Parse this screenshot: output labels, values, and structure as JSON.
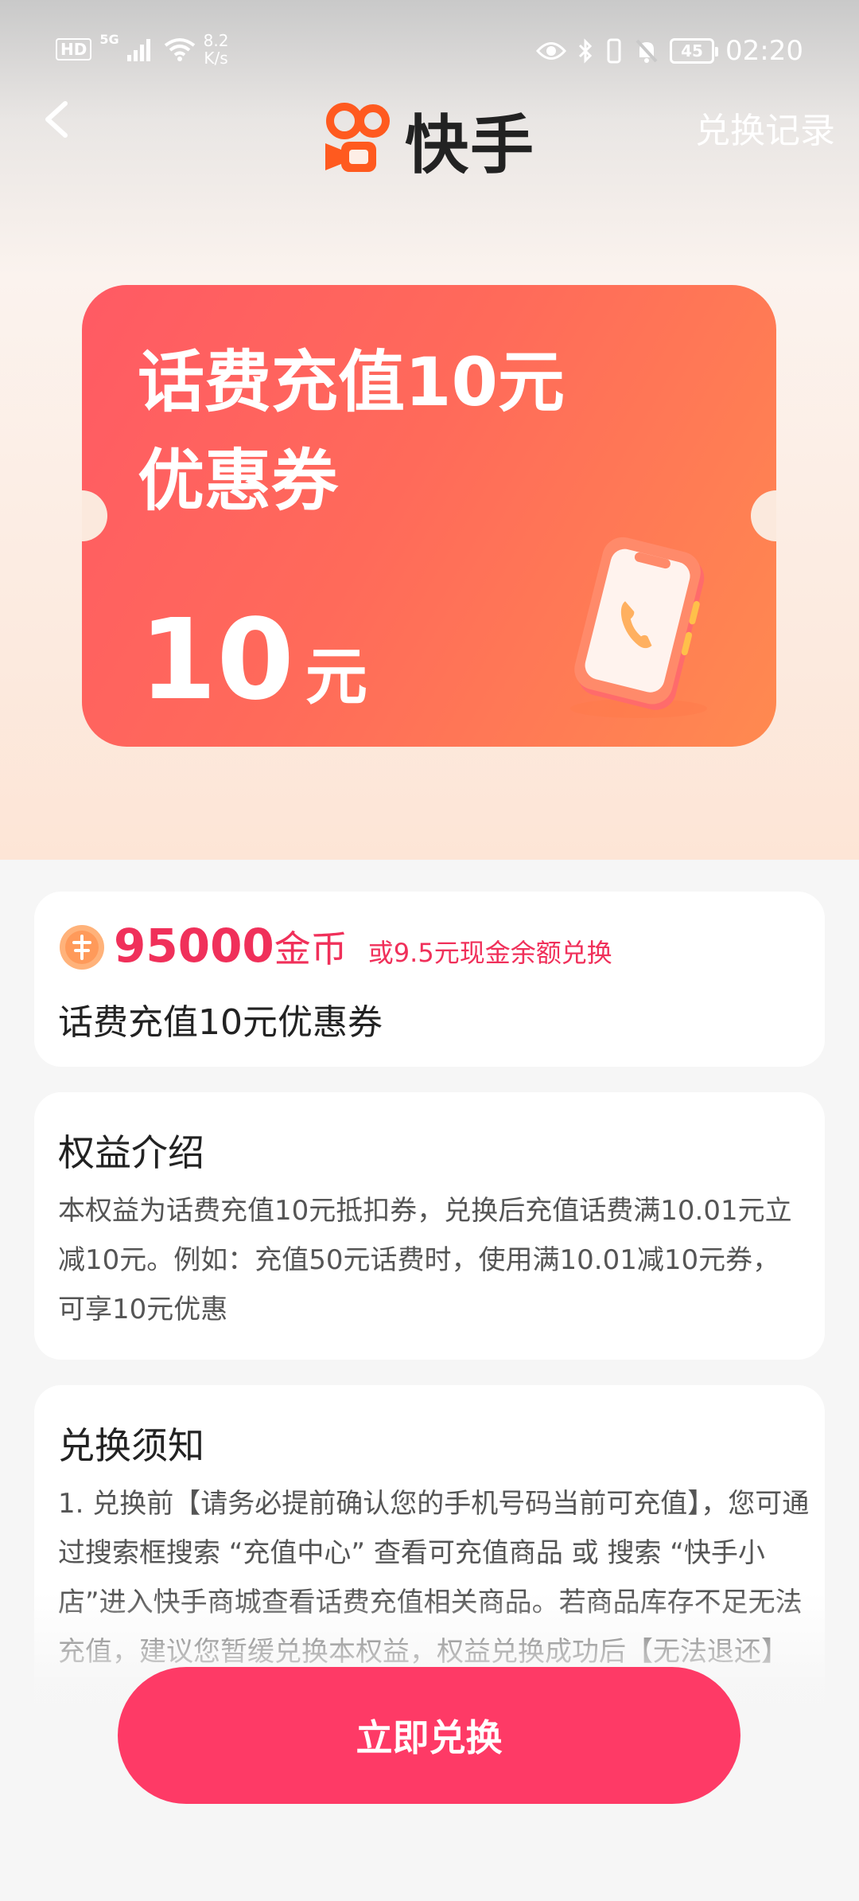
{
  "status_bar": {
    "hd": "HD",
    "network": "5G",
    "speed_value": "8.2",
    "speed_unit": "K/s",
    "battery": "45",
    "time": "02:20"
  },
  "header": {
    "logo_text": "快手",
    "record_link": "兑换记录"
  },
  "coupon": {
    "title_line1": "话费充值10元",
    "title_line2": "优惠券",
    "amount": "10",
    "amount_unit": "元"
  },
  "price_card": {
    "coins": "95000",
    "coins_unit": "金币",
    "alt_price": "或9.5元现金余额兑换",
    "product_name": "话费充值10元优惠券"
  },
  "benefit_card": {
    "title": "权益介绍",
    "body": "本权益为话费充值10元抵扣券，兑换后充值话费满10.01元立减10元。例如：充值50元话费时，使用满10.01减10元券，可享10元优惠"
  },
  "notice_card": {
    "title": "兑换须知",
    "body": "1. 兑换前【请务必提前确认您的手机号码当前可充值】，您可通过搜索框搜索 “充值中心” 查看可充值商品 或 搜索 “快手小店”进入快手商城查看话费充值相关商品。若商品库存不足无法充值，建议您暂缓兑换本权益，权益兑换成功后【无法退还】"
  },
  "action": {
    "redeem_button": "立即兑换"
  },
  "colors": {
    "accent": "#fe3a66",
    "coupon_start": "#ff5a64",
    "coupon_end": "#ff8a50",
    "logo_orange": "#ff5a1f"
  }
}
